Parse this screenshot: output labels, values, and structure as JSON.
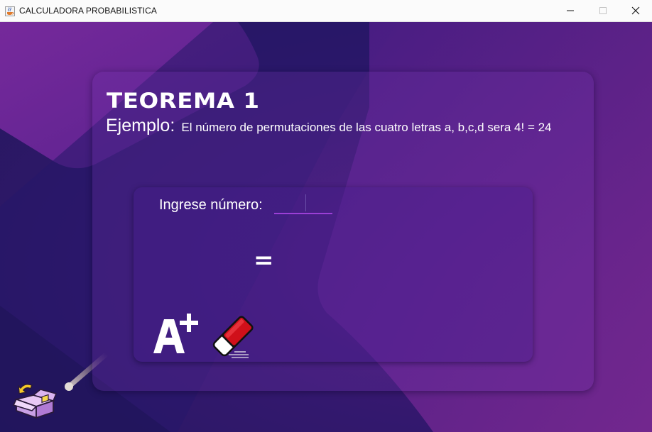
{
  "window": {
    "title": "CALCULADORA PROBABILISTICA",
    "icon": "java-cup-icon",
    "controls": [
      "minimize-icon",
      "maximize-icon",
      "close-icon"
    ]
  },
  "card": {
    "title": "TEOREMA 1",
    "example_label": "Ejemplo:",
    "example_text": "El número de permutaciones de las cuatro letras a, b,c,d sera 4! = 24"
  },
  "calculator": {
    "input_label": "Ingrese número:",
    "input_value": "",
    "input_placeholder": "",
    "equals_sign": "=",
    "result": "",
    "calculate_icon": "a-plus-icon",
    "clear_icon": "eraser-icon"
  },
  "navigation": {
    "back_icon": "box-back-arrow-icon"
  },
  "colors": {
    "background": "#2a1866",
    "accent_purple": "#9b3fd6",
    "eraser_red": "#d0101a",
    "text": "#ffffff"
  }
}
